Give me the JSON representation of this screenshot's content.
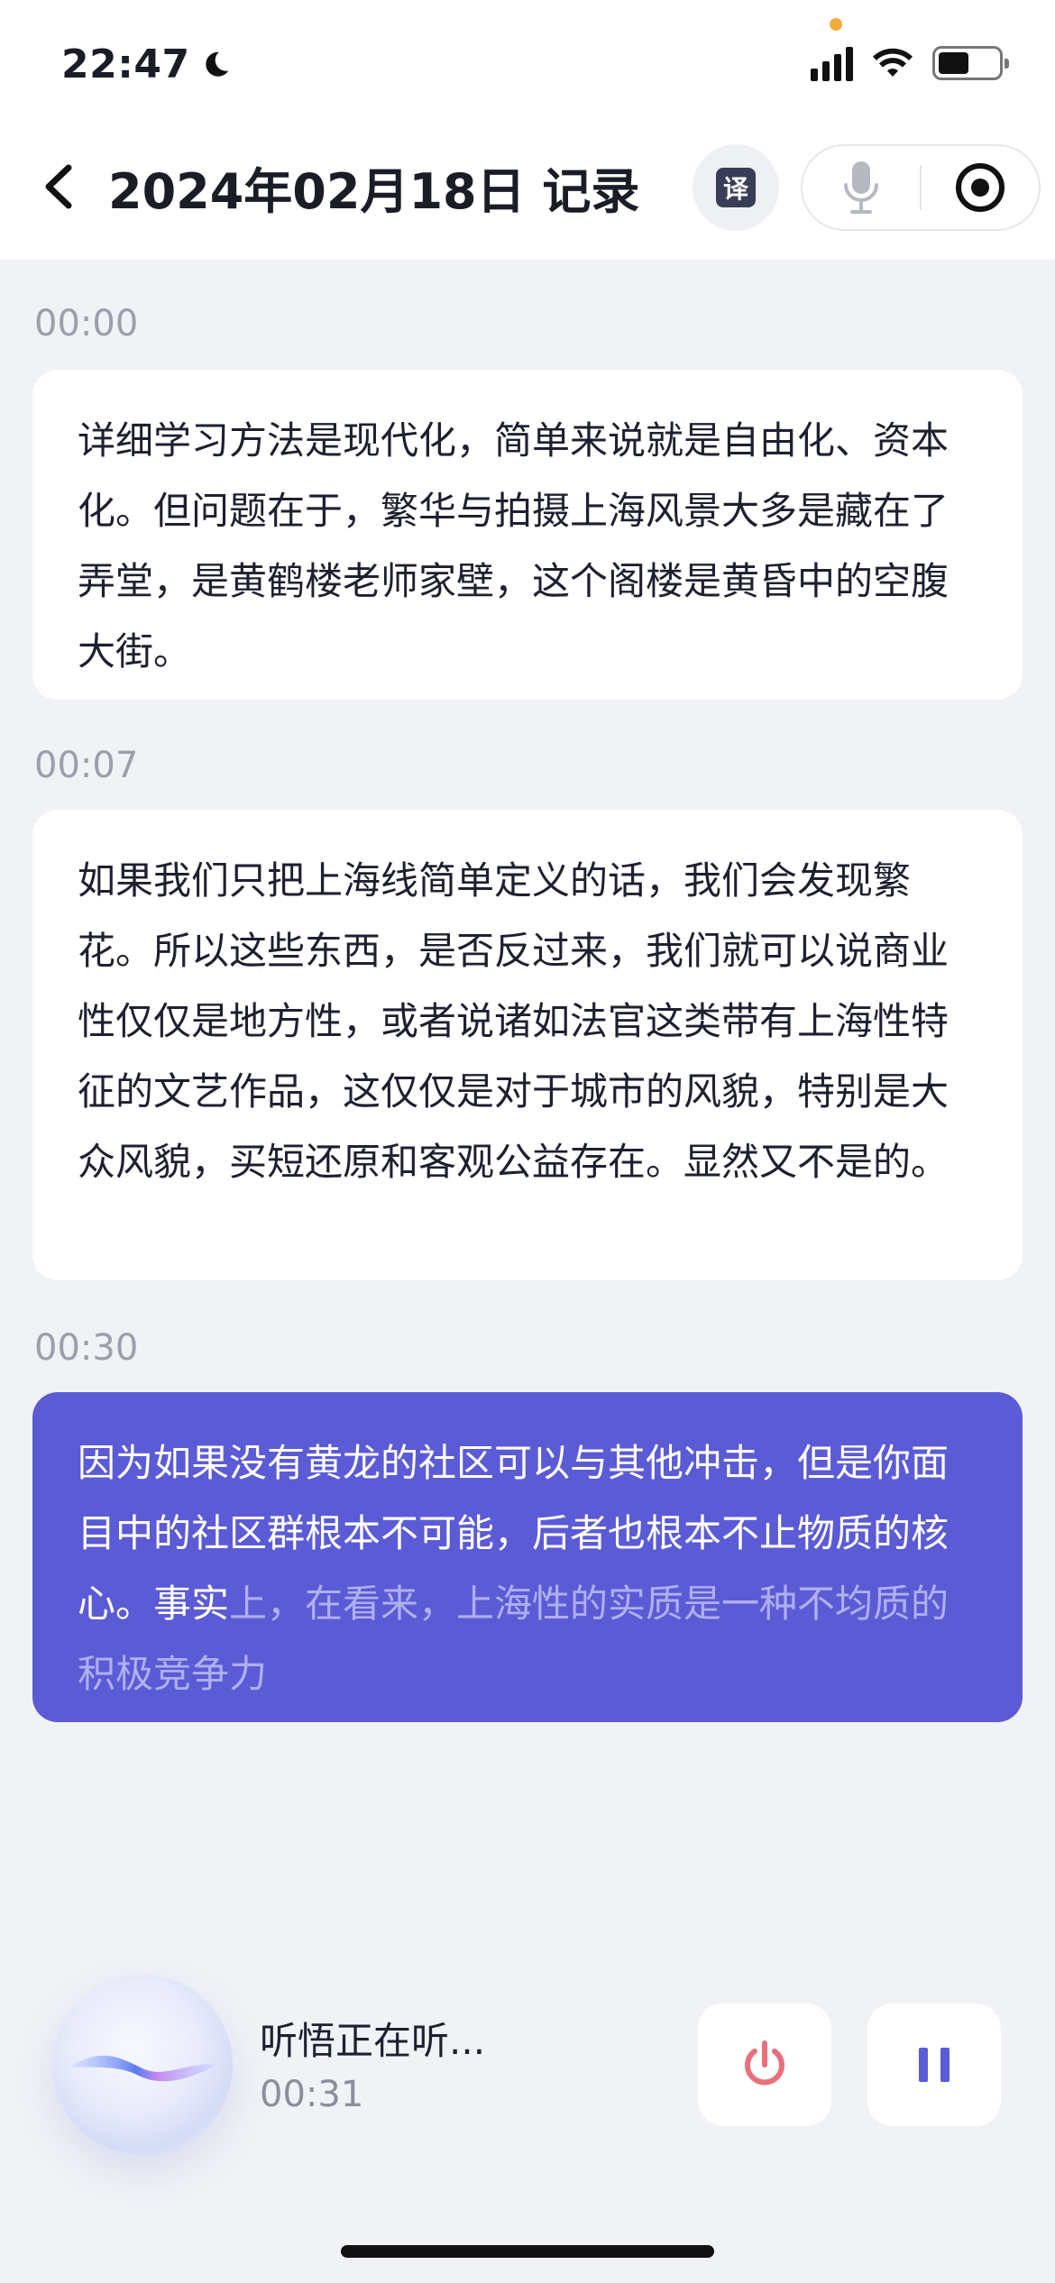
{
  "status": {
    "time": "22:47"
  },
  "nav": {
    "title": "2024年02月18日 记录",
    "translate_label": "译"
  },
  "segments": [
    {
      "time": "00:00",
      "text": "详细学习方法是现代化，简单来说就是自由化、资本化。但问题在于，繁华与拍摄上海风景大多是藏在了弄堂，是黄鹤楼老师家壁，这个阁楼是黄昏中的空腹大街。",
      "text_pending": ""
    },
    {
      "time": "00:07",
      "text": "如果我们只把上海线简单定义的话，我们会发现繁花。所以这些东西，是否反过来，我们就可以说商业性仅仅是地方性，或者说诸如法官这类带有上海性特征的文艺作品，这仅仅是对于城市的风貌，特别是大众风貌，买短还原和客观公益存在。显然又不是的。",
      "text_pending": ""
    },
    {
      "time": "00:30",
      "text": "因为如果没有黄龙的社区可以与其他冲击，但是你面目中的社区群根本不可能，后者也根本不止物质的核心。事实",
      "text_pending": "上，在看来，上海性的实质是一种不均质的积极竞争力"
    }
  ],
  "listening": {
    "label": "听悟正在听...",
    "elapsed": "00:31"
  },
  "colors": {
    "accent": "#5b5bd6",
    "stop_icon": "#e8707a",
    "pause_icon": "#5b5bd6"
  },
  "icons": [
    "moon-icon",
    "signal-icon",
    "wifi-icon",
    "battery-icon",
    "back-chevron-icon",
    "translate-icon",
    "microphone-icon",
    "record-icon",
    "power-icon",
    "pause-icon"
  ]
}
